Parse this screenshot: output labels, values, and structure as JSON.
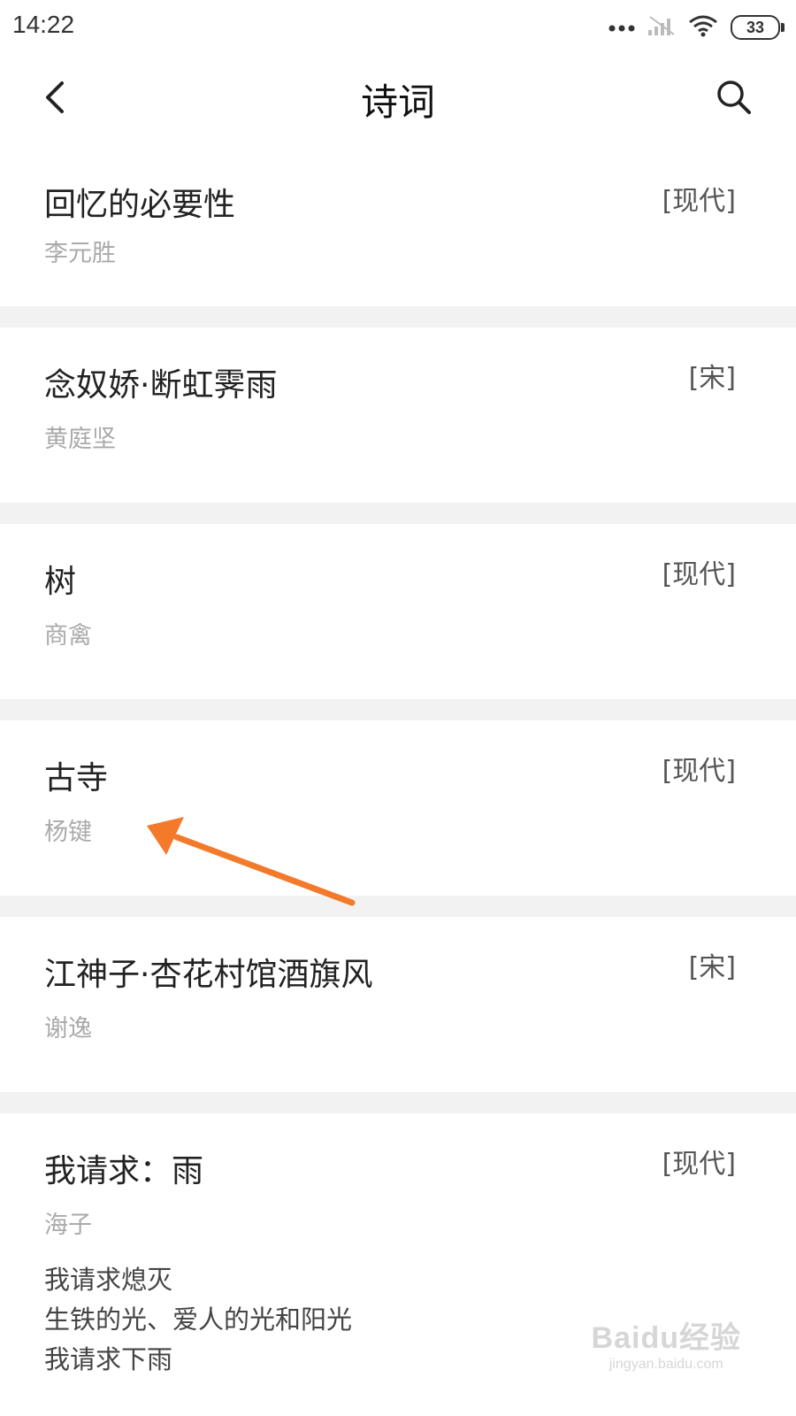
{
  "status_bar": {
    "time": "14:22",
    "battery": "33",
    "icons": [
      "more-dots-icon",
      "signal-icon",
      "wifi-icon",
      "battery-icon"
    ]
  },
  "nav": {
    "title": "诗词",
    "back_icon": "back-arrow-icon",
    "search_icon": "search-icon"
  },
  "poems": [
    {
      "title": "回忆的必要性",
      "author": "李元胜",
      "era": "[现代]"
    },
    {
      "title": "念奴娇·断虹霁雨",
      "author": "黄庭坚",
      "era": "[宋]"
    },
    {
      "title": "树",
      "author": "商禽",
      "era": "[现代]"
    },
    {
      "title": "古寺",
      "author": "杨键",
      "era": "[现代]"
    },
    {
      "title": "江神子·杏花村馆酒旗风",
      "author": "谢逸",
      "era": "[宋]"
    },
    {
      "title": "我请求：雨",
      "author": "海子",
      "era": "[现代]",
      "excerpt": [
        "我请求熄灭",
        "生铁的光、爱人的光和阳光",
        "我请求下雨"
      ]
    }
  ],
  "annotation": {
    "color": "#f47a2b"
  },
  "watermark": {
    "logo": "Baidu经验",
    "url": "jingyan.baidu.com"
  }
}
